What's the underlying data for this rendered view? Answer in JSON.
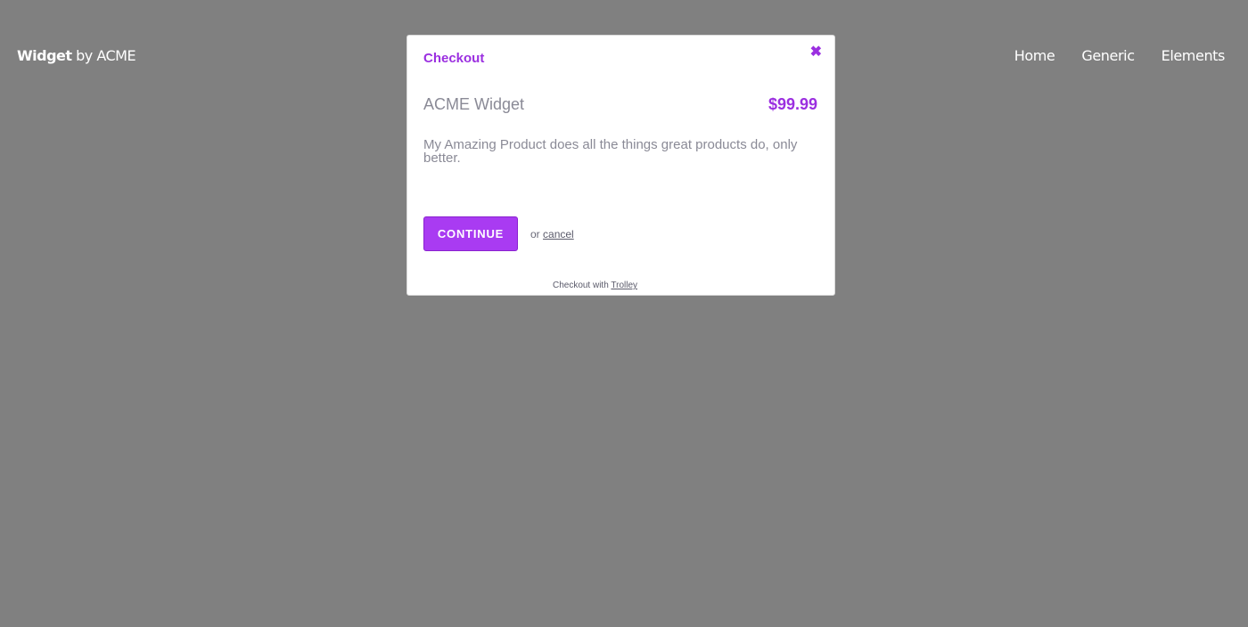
{
  "header": {
    "brand_bold": "Widget",
    "brand_rest": " by ACME",
    "nav": [
      {
        "label": "Home"
      },
      {
        "label": "Generic"
      },
      {
        "label": "Elements"
      }
    ]
  },
  "modal": {
    "title": "Checkout",
    "close_glyph": "✖",
    "product_name": "ACME Widget",
    "price": "$99.99",
    "description": "My Amazing Product does all the things great products do, only better.",
    "continue_label": "CONTINUE",
    "or_text": "or ",
    "cancel_label": "cancel",
    "footer_prefix": "Checkout with ",
    "footer_link": "Trolley"
  },
  "colors": {
    "backdrop": "#808080",
    "accent": "#9b2fe0",
    "button": "#a93bf2"
  }
}
